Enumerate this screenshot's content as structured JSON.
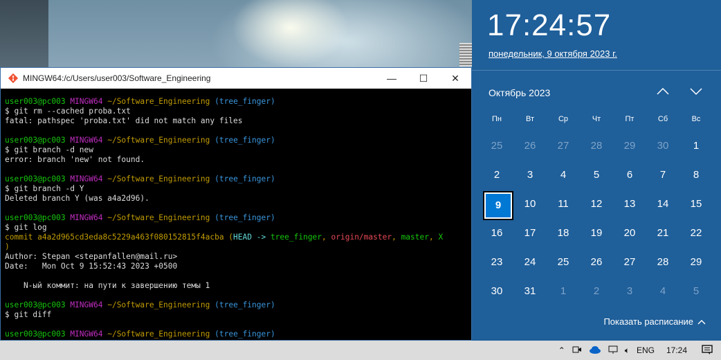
{
  "window": {
    "title": "MINGW64:/c/Users/user003/Software_Engineering",
    "minimize": "—",
    "maximize": "☐",
    "close": "✕"
  },
  "terminal": {
    "lines": [
      {
        "kind": "prompt",
        "user": "user003@pc003",
        "shell": "MINGW64",
        "path": "~/Software_Engineering",
        "branch": "(tree_finger)"
      },
      {
        "kind": "text",
        "text": "$ git rm --cached proba.txt"
      },
      {
        "kind": "text",
        "text": "fatal: pathspec 'proba.txt' did not match any files"
      },
      {
        "kind": "blank"
      },
      {
        "kind": "prompt",
        "user": "user003@pc003",
        "shell": "MINGW64",
        "path": "~/Software_Engineering",
        "branch": "(tree_finger)"
      },
      {
        "kind": "text",
        "text": "$ git branch -d new"
      },
      {
        "kind": "text",
        "text": "error: branch 'new' not found."
      },
      {
        "kind": "blank"
      },
      {
        "kind": "prompt",
        "user": "user003@pc003",
        "shell": "MINGW64",
        "path": "~/Software_Engineering",
        "branch": "(tree_finger)"
      },
      {
        "kind": "text",
        "text": "$ git branch -d Y"
      },
      {
        "kind": "text",
        "text": "Deleted branch Y (was a4a2d96)."
      },
      {
        "kind": "blank"
      },
      {
        "kind": "prompt",
        "user": "user003@pc003",
        "shell": "MINGW64",
        "path": "~/Software_Engineering",
        "branch": "(tree_finger)"
      },
      {
        "kind": "text",
        "text": "$ git log"
      },
      {
        "kind": "commit",
        "hash": "commit a4a2d965cd3eda8c5229a463f080152815f4acba",
        "head": "HEAD -> ",
        "branch": "tree_finger",
        "origin": "origin/master",
        "master": "master",
        "x": "X"
      },
      {
        "kind": "text",
        "text": ")"
      },
      {
        "kind": "text",
        "text": "Author: Stepan <stepanfallen@mail.ru>"
      },
      {
        "kind": "text",
        "text": "Date:   Mon Oct 9 15:52:43 2023 +0500"
      },
      {
        "kind": "blank"
      },
      {
        "kind": "text",
        "text": "    N-ый коммит: на пути к завершению темы 1"
      },
      {
        "kind": "blank"
      },
      {
        "kind": "prompt",
        "user": "user003@pc003",
        "shell": "MINGW64",
        "path": "~/Software_Engineering",
        "branch": "(tree_finger)"
      },
      {
        "kind": "text",
        "text": "$ git diff"
      },
      {
        "kind": "blank"
      },
      {
        "kind": "prompt",
        "user": "user003@pc003",
        "shell": "MINGW64",
        "path": "~/Software_Engineering",
        "branch": "(tree_finger)"
      }
    ]
  },
  "calendar": {
    "time": "17:24:57",
    "date_link": "понедельник, 9 октября 2023 г.",
    "month_label": "Октябрь 2023",
    "weekdays": [
      "Пн",
      "Вт",
      "Ср",
      "Чт",
      "Пт",
      "Сб",
      "Вс"
    ],
    "weeks": [
      [
        {
          "d": "25",
          "o": true
        },
        {
          "d": "26",
          "o": true
        },
        {
          "d": "27",
          "o": true
        },
        {
          "d": "28",
          "o": true
        },
        {
          "d": "29",
          "o": true
        },
        {
          "d": "30",
          "o": true
        },
        {
          "d": "1",
          "o": false
        }
      ],
      [
        {
          "d": "2",
          "o": false
        },
        {
          "d": "3",
          "o": false
        },
        {
          "d": "4",
          "o": false
        },
        {
          "d": "5",
          "o": false
        },
        {
          "d": "6",
          "o": false
        },
        {
          "d": "7",
          "o": false
        },
        {
          "d": "8",
          "o": false
        }
      ],
      [
        {
          "d": "9",
          "o": false,
          "today": true
        },
        {
          "d": "10",
          "o": false
        },
        {
          "d": "11",
          "o": false
        },
        {
          "d": "12",
          "o": false
        },
        {
          "d": "13",
          "o": false
        },
        {
          "d": "14",
          "o": false
        },
        {
          "d": "15",
          "o": false
        }
      ],
      [
        {
          "d": "16",
          "o": false
        },
        {
          "d": "17",
          "o": false
        },
        {
          "d": "18",
          "o": false
        },
        {
          "d": "19",
          "o": false
        },
        {
          "d": "20",
          "o": false
        },
        {
          "d": "21",
          "o": false
        },
        {
          "d": "22",
          "o": false
        }
      ],
      [
        {
          "d": "23",
          "o": false
        },
        {
          "d": "24",
          "o": false
        },
        {
          "d": "25",
          "o": false
        },
        {
          "d": "26",
          "o": false
        },
        {
          "d": "27",
          "o": false
        },
        {
          "d": "28",
          "o": false
        },
        {
          "d": "29",
          "o": false
        }
      ],
      [
        {
          "d": "30",
          "o": false
        },
        {
          "d": "31",
          "o": false
        },
        {
          "d": "1",
          "o": true
        },
        {
          "d": "2",
          "o": true
        },
        {
          "d": "3",
          "o": true
        },
        {
          "d": "4",
          "o": true
        },
        {
          "d": "5",
          "o": true
        }
      ]
    ],
    "show_schedule": "Показать расписание"
  },
  "taskbar": {
    "language": "ENG",
    "time": "17:24"
  },
  "colors": {
    "flyout_bg": "#1f5f9a",
    "today_bg": "#0078d4",
    "prompt_user": "#16c60c",
    "prompt_shell": "#c12ec1",
    "prompt_path": "#c19c00",
    "prompt_branch": "#3a96dd"
  }
}
